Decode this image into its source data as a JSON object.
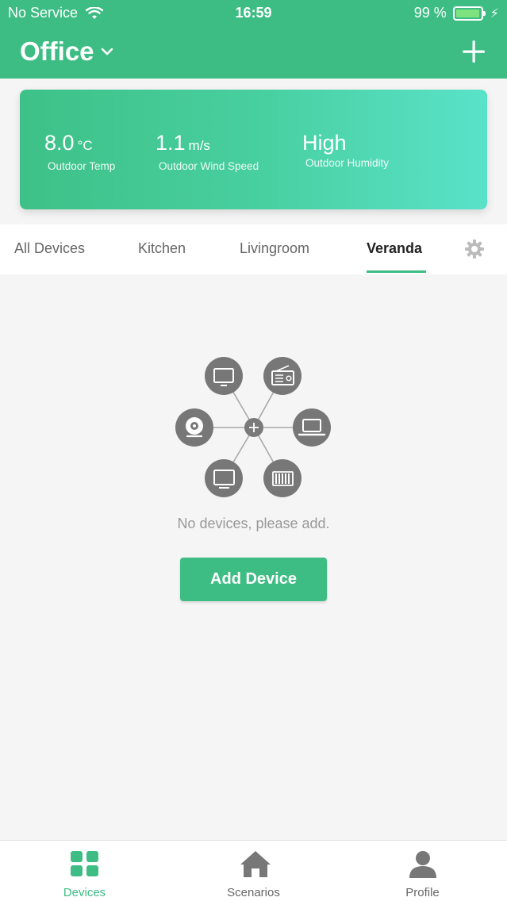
{
  "status_bar": {
    "carrier": "No Service",
    "time": "16:59",
    "battery_percent": "99 %",
    "battery_level": 0.99
  },
  "header": {
    "home_name": "Office",
    "add_icon": "plus-icon",
    "dropdown_icon": "chevron-down-icon"
  },
  "weather": {
    "temp_value": "8.0",
    "temp_unit": "°C",
    "temp_label": "Outdoor Temp",
    "wind_value": "1.1",
    "wind_unit": "m/s",
    "wind_label": "Outdoor Wind Speed",
    "humidity_value": "High",
    "humidity_label": "Outdoor Humidity"
  },
  "tabs": [
    {
      "label": "All Devices",
      "active": false
    },
    {
      "label": "Kitchen",
      "active": false
    },
    {
      "label": "Livingroom",
      "active": false
    },
    {
      "label": "Veranda",
      "active": true
    }
  ],
  "empty_state": {
    "message": "No devices, please add.",
    "button_label": "Add Device"
  },
  "bottom_nav": [
    {
      "label": "Devices",
      "icon": "grid-icon",
      "active": true
    },
    {
      "label": "Scenarios",
      "icon": "home-icon",
      "active": false
    },
    {
      "label": "Profile",
      "icon": "person-icon",
      "active": false
    }
  ],
  "colors": {
    "brand": "#3dbd84",
    "icon_gray": "#777777"
  }
}
